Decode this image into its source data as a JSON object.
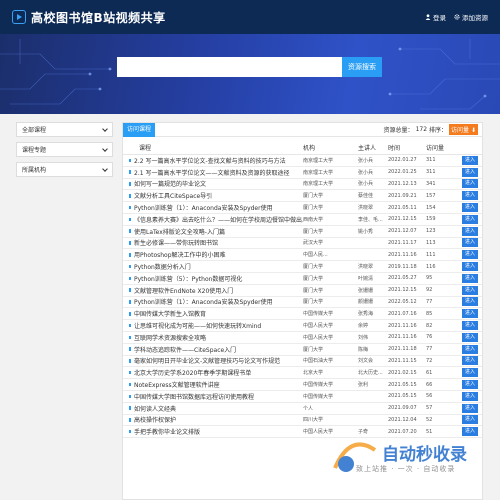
{
  "header": {
    "title": "高校图书馆B站视频共享",
    "login_label": "登录",
    "add_label": "添加资源"
  },
  "search": {
    "placeholder": "",
    "button_label": "资源搜索"
  },
  "sidebar": {
    "items": [
      {
        "label": "全部课程"
      },
      {
        "label": "课程专题"
      },
      {
        "label": "所属机构"
      }
    ]
  },
  "main": {
    "tab_label": "访问课程",
    "count_prefix": "资源总量：",
    "count_value": "172",
    "sort_label": "排序：",
    "sort_button": "访问量",
    "columns": [
      "课程",
      "机构",
      "主讲人",
      "时间",
      "访问量"
    ],
    "enter_label": "进入",
    "rows": [
      {
        "title": "2.2 写一篇高水平学位论文-查找文献与资料的技巧与方法",
        "org": "南京理工大学",
        "author": "张小兵",
        "time": "2022.01.27",
        "views": "311"
      },
      {
        "title": "2.1 写一篇高水平学位论文——文献资料及资源的获取途径",
        "org": "南京理工大学",
        "author": "张小兵",
        "time": "2022.01.25",
        "views": "311"
      },
      {
        "title": "如何写一篇规范的毕业论文",
        "org": "南京理工大学",
        "author": "张小兵",
        "time": "2021.12.13",
        "views": "341"
      },
      {
        "title": "文献分析工具CiteSpace导引",
        "org": "厦门大学",
        "author": "蔡佳佳",
        "time": "2021.09.21",
        "views": "157"
      },
      {
        "title": "Python训练营（1）：Anaconda安装及Spyder使用",
        "org": "厦门大学",
        "author": "洪晓翠",
        "time": "2021.05.11",
        "views": "154"
      },
      {
        "title": "《信息素养大赛》出去吃什么？——如何在学校周边餐馆中做出...",
        "org": "西南大学",
        "author": "李佳、毛...",
        "time": "2021.12.15",
        "views": "159"
      },
      {
        "title": "使用LaTex排版论文全攻略-入门篇",
        "org": "厦门大学",
        "author": "姚小秀",
        "time": "2021.12.07",
        "views": "123"
      },
      {
        "title": "新生必修课——带你玩转图书馆",
        "org": "武汉大学",
        "author": "",
        "time": "2021.11.17",
        "views": "113"
      },
      {
        "title": "用Photoshop解决工作中的小困难",
        "org": "中国人民...",
        "author": "",
        "time": "2021.11.16",
        "views": "111"
      },
      {
        "title": "Python数据分析入门",
        "org": "厦门大学",
        "author": "洪晓翠",
        "time": "2019.11.18",
        "views": "116"
      },
      {
        "title": "Python训练营（5）：Python数据可视化",
        "org": "厦门大学",
        "author": "叶婉清",
        "time": "2021.05.27",
        "views": "95"
      },
      {
        "title": "文献管理软件EndNote X20使用入门",
        "org": "厦门大学",
        "author": "张姗姗",
        "time": "2021.12.15",
        "views": "92"
      },
      {
        "title": "Python训练营（1）：Anaconda安装及Spyder使用",
        "org": "厦门大学",
        "author": "颜姗姗",
        "time": "2022.05.12",
        "views": "77"
      },
      {
        "title": "中国传媒大学新生入馆教育",
        "org": "中国传媒大学",
        "author": "张秀海",
        "time": "2021.07.16",
        "views": "85"
      },
      {
        "title": "让思维可视化成为可能——如何快速玩转Xmind",
        "org": "中国人民大学",
        "author": "余婷",
        "time": "2021.11.16",
        "views": "82"
      },
      {
        "title": "互联网学术资源搜索全攻略",
        "org": "中国人民大学",
        "author": "刘伟",
        "time": "2021.11.16",
        "views": "76"
      },
      {
        "title": "学科动态追踪软件——CiteSpace入门",
        "org": "厦门大学",
        "author": "陈梅",
        "time": "2021.11.18",
        "views": "77"
      },
      {
        "title": "毫家如何明日开毕业论文-文献管理技巧与论文写作规范",
        "org": "中国石油大学",
        "author": "刘文会",
        "time": "2021.11.15",
        "views": "72"
      },
      {
        "title": "北京大学历史学系2020年春季学期课程书单",
        "org": "北京大学",
        "author": "北大历史...",
        "time": "2021.02.15",
        "views": "61"
      },
      {
        "title": "NoteExpress文献管理软件讲座",
        "org": "中国传媒大学",
        "author": "张利",
        "time": "2021.05.15",
        "views": "66"
      },
      {
        "title": "中国传媒大学图书馆数据库远程访问使用教程",
        "org": "中国传媒大学",
        "author": "",
        "time": "2021.05.15",
        "views": "56"
      },
      {
        "title": "如何读人文经典",
        "org": "个人",
        "author": "",
        "time": "2021.09.07",
        "views": "57"
      },
      {
        "title": "高校操作权保护",
        "org": "四川大学",
        "author": "",
        "time": "2021.12.04",
        "views": "52"
      },
      {
        "title": "手把手教你毕业论文排版",
        "org": "中国人民大学",
        "author": "子奇",
        "time": "2021.07.20",
        "views": "51"
      }
    ]
  },
  "watermark": {
    "text": "自动秒收录",
    "subtext": "致上站推 · 一次 · 自动收录"
  },
  "colors": {
    "topbar": "#0d2a55",
    "accent": "#2a9df4",
    "sort": "#f57b1f",
    "enter": "#2a7de1"
  }
}
